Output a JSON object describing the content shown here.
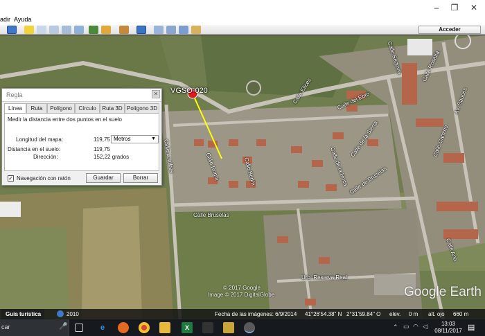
{
  "window": {
    "minimize_glyph": "–",
    "restore_glyph": "❐",
    "close_glyph": "✕"
  },
  "menu": {
    "items": [
      "adir",
      "Ayuda"
    ]
  },
  "toolbar": {
    "acceder_label": "Acceder"
  },
  "map": {
    "placemark_label": "VGSO-020",
    "streets": {
      "calle_elices": "Calle Elices",
      "calle_del_ebro": "Calle del Ebro",
      "calle_segovia": "Calle Segovia",
      "calle_la_sierra": "Calle de la Sierra",
      "calle_de_la_roca": "Calle de la Roca",
      "calle_rio_eresma": "Calle Río Eresma",
      "calle_rio_pirón": "Calle Río Pirón",
      "calle_bruselas": "Calle Bruselas",
      "calle_bruselas_2": "Calle de Bruselas",
      "calle_londres": "Calle Londres",
      "calle_roma": "Calle Roma",
      "calle_berlin": "Calle Berlín",
      "calle_paris": "Calle París",
      "av_sauces": "Av. Sauces",
      "calle_rosalia": "Calle Rosalía",
      "calle_camino": "Calle Camino",
      "calle_ana": "Calle Ana",
      "urb": "Urb. Reserva Real"
    },
    "copyright_1": "© 2017 Google",
    "copyright_2": "Image © 2017 DigitalGlobe",
    "brand": "Google Earth"
  },
  "status": {
    "guia": "Guía turística",
    "year": "2010",
    "fecha": "Fecha de las imágenes: 6/9/2014",
    "lat": "41°26'54.38\" N",
    "lon": "2°31'59.84\" O",
    "elev": "elev.",
    "elev_value": "0 m",
    "alt": "alt. ojo",
    "alt_value": "660 m"
  },
  "dialog": {
    "title": "Regla",
    "close_glyph": "✕",
    "tabs": [
      "Línea",
      "Ruta",
      "Polígono",
      "Círculo",
      "Ruta 3D",
      "Polígono 3D"
    ],
    "active_tab": "Línea",
    "instruction": "Medir la distancia entre dos puntos en el suelo",
    "longitud_label": "Longitud del mapa:",
    "longitud_value": "119,75",
    "units_selected": "Metros",
    "distancia_label": "Distancia en el suelo:",
    "distancia_value": "119,75",
    "direccion_label": "Dirección:",
    "direccion_value": "152,22 grados",
    "nav_label": "Navegación con ratón",
    "nav_checked": "✓",
    "guardar_label": "Guardar",
    "borrar_label": "Borrar"
  },
  "taskbar": {
    "search_text": "car",
    "time": "13:03",
    "date": "08/11/2017"
  }
}
